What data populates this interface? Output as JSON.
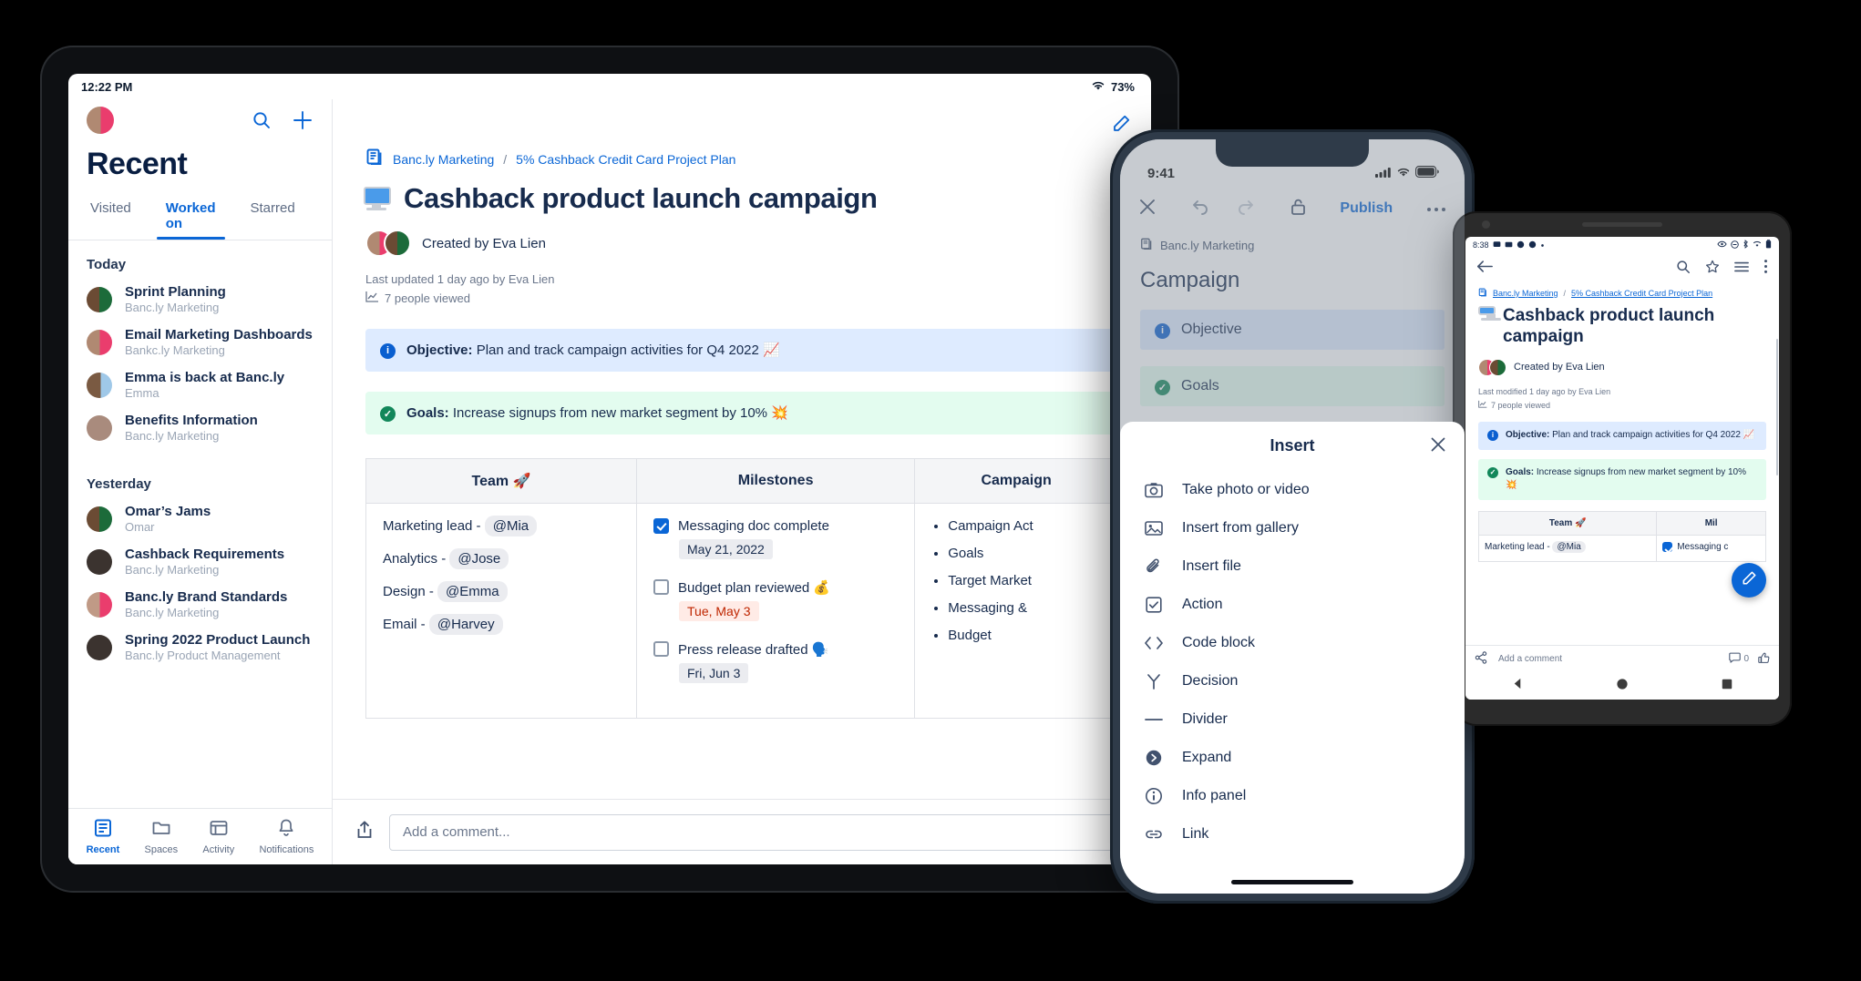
{
  "tablet": {
    "status": {
      "time": "12:22 PM",
      "battery": "73%",
      "wifi_icon": "wifi-icon"
    },
    "sidebar": {
      "title": "Recent",
      "tabs": [
        {
          "label": "Visited",
          "active": false
        },
        {
          "label": "Worked on",
          "active": true
        },
        {
          "label": "Starred",
          "active": false
        }
      ],
      "groups": [
        {
          "label": "Today",
          "items": [
            {
              "name": "Sprint Planning",
              "sub": "Banc.ly Marketing",
              "avatar": "av-b"
            },
            {
              "name": "Email Marketing Dashboards",
              "sub": "Bankc.ly Marketing",
              "avatar": "av-a"
            },
            {
              "name": "Emma is back at Banc.ly",
              "sub": "Emma",
              "avatar": "av-c"
            },
            {
              "name": "Benefits Information",
              "sub": "Banc.ly Marketing",
              "avatar": "av-d"
            }
          ]
        },
        {
          "label": "Yesterday",
          "items": [
            {
              "name": "Omar’s Jams",
              "sub": "Omar",
              "avatar": "av-b"
            },
            {
              "name": "Cashback Requirements",
              "sub": "Banc.ly Marketing",
              "avatar": "av-e"
            },
            {
              "name": "Banc.ly Brand Standards",
              "sub": "Banc.ly Marketing",
              "avatar": "av-f"
            },
            {
              "name": "Spring 2022 Product Launch",
              "sub": "Banc.ly Product Management",
              "avatar": "av-e"
            }
          ]
        }
      ],
      "bottom_nav": [
        {
          "label": "Recent",
          "icon": "recent-page-icon",
          "active": true
        },
        {
          "label": "Spaces",
          "icon": "folder-icon",
          "active": false
        },
        {
          "label": "Activity",
          "icon": "activity-window-icon",
          "active": false
        },
        {
          "label": "Notifications",
          "icon": "bell-icon",
          "active": false
        }
      ],
      "search_icon": "search-icon",
      "add_icon": "plus-icon"
    },
    "main": {
      "edit_icon": "pencil-edit-icon",
      "breadcrumb": {
        "space_icon": "pages-icon",
        "space": "Banc.ly Marketing",
        "separator": "/",
        "page": "5% Cashback Credit Card Project Plan"
      },
      "title": "Cashback product launch campaign",
      "title_icon": "monitor-emoji-icon",
      "created_by": "Created by Eva Lien",
      "last_updated": "Last updated 1 day ago by Eva Lien",
      "views": "7 people viewed",
      "views_icon": "chart-trend-icon",
      "panels": [
        {
          "kind": "info",
          "icon": "info-circle-icon",
          "label": "Objective:",
          "text": " Plan and track campaign activities for Q4 2022 📈"
        },
        {
          "kind": "ok",
          "icon": "check-circle-icon",
          "label": "Goals:",
          "text": " Increase signups from new market segment by 10% 💥"
        }
      ],
      "table": {
        "headers": [
          "Team 🚀",
          "Milestones",
          "Campaign"
        ],
        "team": [
          {
            "role": "Marketing lead -",
            "mention": "@Mia"
          },
          {
            "role": "Analytics -",
            "mention": "@Jose"
          },
          {
            "role": "Design -",
            "mention": "@Emma"
          },
          {
            "role": "Email -",
            "mention": "@Harvey"
          }
        ],
        "milestones": [
          {
            "text": "Messaging doc complete",
            "checked": true,
            "date": "May 21, 2022",
            "date_style": "grey"
          },
          {
            "text": "Budget plan reviewed 💰",
            "checked": false,
            "date": "Tue, May 3",
            "date_style": "red"
          },
          {
            "text": "Press release drafted 🗣️",
            "checked": false,
            "date": "Fri, Jun 3",
            "date_style": "grey"
          }
        ],
        "campaign": [
          "Campaign Act",
          "Goals",
          "Target Market",
          "Messaging &",
          "Budget"
        ]
      },
      "comment_placeholder": "Add a comment...",
      "share_icon": "share-icon"
    }
  },
  "iphone": {
    "status": {
      "time": "9:41",
      "signal_icon": "cellular-icon",
      "wifi_icon": "wifi-icon",
      "battery_icon": "battery-icon"
    },
    "toolbar": {
      "close_icon": "close-x-icon",
      "undo_icon": "undo-icon",
      "redo_icon": "redo-icon",
      "lock_icon": "unlock-icon",
      "publish_label": "Publish",
      "more_icon": "more-horizontal-icon"
    },
    "doc": {
      "space_icon": "pages-icon",
      "space": "Banc.ly Marketing",
      "title": "Campaign",
      "panels": [
        {
          "kind": "info",
          "icon": "info-circle-icon",
          "label": "Objective"
        },
        {
          "kind": "ok",
          "icon": "check-circle-icon",
          "label": "Goals"
        }
      ]
    },
    "insert_sheet": {
      "title": "Insert",
      "close_icon": "close-x-icon",
      "items": [
        {
          "label": "Take photo or video",
          "icon": "camera-icon"
        },
        {
          "label": "Insert from gallery",
          "icon": "image-icon"
        },
        {
          "label": "Insert file",
          "icon": "paperclip-icon"
        },
        {
          "label": "Action",
          "icon": "checkbox-icon"
        },
        {
          "label": "Code block",
          "icon": "code-brackets-icon"
        },
        {
          "label": "Decision",
          "icon": "decision-fork-icon"
        },
        {
          "label": "Divider",
          "icon": "divider-line-icon"
        },
        {
          "label": "Expand",
          "icon": "expand-chevron-icon"
        },
        {
          "label": "Info panel",
          "icon": "info-circle-icon"
        },
        {
          "label": "Link",
          "icon": "link-icon"
        }
      ]
    }
  },
  "android": {
    "status": {
      "time": "8:38",
      "left_icons": [
        "message-icon",
        "mail-icon",
        "photo-icon",
        "info-icon",
        "dot-icon"
      ],
      "right_icons": [
        "eye-icon",
        "minus-circle-icon",
        "bluetooth-icon",
        "wifi-icon",
        "battery-icon"
      ]
    },
    "appbar": {
      "back_icon": "back-arrow-icon",
      "search_icon": "search-icon",
      "star_icon": "star-icon",
      "list_icon": "list-icon",
      "more_icon": "more-vertical-icon"
    },
    "doc": {
      "space_icon": "pages-icon",
      "space": "Banc.ly Marketing",
      "separator": "/",
      "page": "5% Cashback Credit Card Project Plan",
      "title": "Cashback product launch campaign",
      "title_icon": "monitor-emoji-icon",
      "created_by": "Created by Eva Lien",
      "last_modified": "Last modified 1 day ago by Eva Lien",
      "views": "7 people viewed",
      "views_icon": "chart-trend-icon",
      "panels": [
        {
          "kind": "info",
          "icon": "info-circle-icon",
          "label": "Objective:",
          "text": " Plan and track campaign activities for Q4 2022 📈"
        },
        {
          "kind": "ok",
          "icon": "check-circle-icon",
          "label": "Goals:",
          "text": " Increase signups from new market segment by 10% 💥"
        }
      ],
      "table": {
        "headers": [
          "Team 🚀",
          "Mil"
        ],
        "row": {
          "team": "Marketing lead -",
          "mention": "@Mia",
          "milestone": "Messaging c",
          "checked": true
        }
      },
      "fab_icon": "pencil-edit-icon"
    },
    "comment_bar": {
      "share_icon": "share-icon",
      "placeholder": "Add a comment",
      "comment_icon": "comment-icon",
      "comment_count": "0",
      "like_icon": "thumbs-up-icon"
    },
    "nav": {
      "back_icon": "nav-back-triangle-icon",
      "home_icon": "nav-home-circle-icon",
      "recents_icon": "nav-recents-square-icon"
    }
  }
}
